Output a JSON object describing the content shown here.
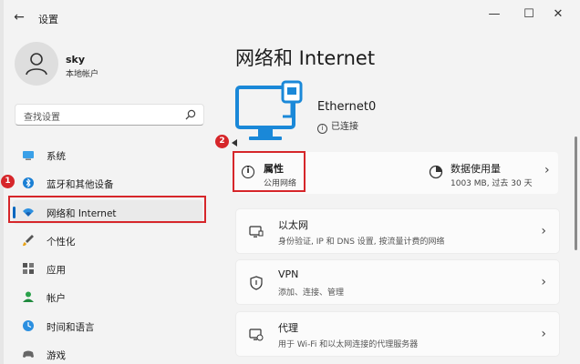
{
  "window": {
    "title": "设置",
    "back_glyph": "←",
    "minimize_glyph": "—",
    "maximize_glyph": "☐",
    "close_glyph": "✕"
  },
  "user": {
    "name": "sky",
    "subtitle": "本地帐户"
  },
  "search": {
    "placeholder": "查找设置"
  },
  "sidebar": {
    "items": [
      {
        "label": "系统",
        "icon": "monitor-icon"
      },
      {
        "label": "蓝牙和其他设备",
        "icon": "bluetooth-icon"
      },
      {
        "label": "网络和 Internet",
        "icon": "wifi-icon",
        "active": true
      },
      {
        "label": "个性化",
        "icon": "brush-icon"
      },
      {
        "label": "应用",
        "icon": "apps-icon"
      },
      {
        "label": "帐户",
        "icon": "account-icon"
      },
      {
        "label": "时间和语言",
        "icon": "globe-clock-icon"
      },
      {
        "label": "游戏",
        "icon": "gamepad-icon"
      }
    ]
  },
  "annotations": {
    "step1": "1",
    "step2": "2"
  },
  "main": {
    "title": "网络和 Internet",
    "adapter": {
      "name": "Ethernet0",
      "status": "已连接",
      "status_icon_glyph": "i"
    },
    "properties": {
      "title": "属性",
      "subtitle": "公用网络",
      "icon_glyph": "i"
    },
    "data_usage": {
      "title": "数据使用量",
      "subtitle": "1003 MB, 过去 30 天"
    },
    "cards": [
      {
        "title": "以太网",
        "subtitle": "身份验证, IP 和 DNS 设置, 按流量计费的网络",
        "icon": "ethernet-monitor-icon"
      },
      {
        "title": "VPN",
        "subtitle": "添加、连接、管理",
        "icon": "shield-icon"
      },
      {
        "title": "代理",
        "subtitle": "用于 Wi-Fi 和以太网连接的代理服务器",
        "icon": "proxy-monitor-icon"
      }
    ],
    "chevron_glyph": "›"
  },
  "colors": {
    "accent": "#0067c0",
    "annotation_red": "#d6262a",
    "monitor_blue": "#1a88d8"
  }
}
